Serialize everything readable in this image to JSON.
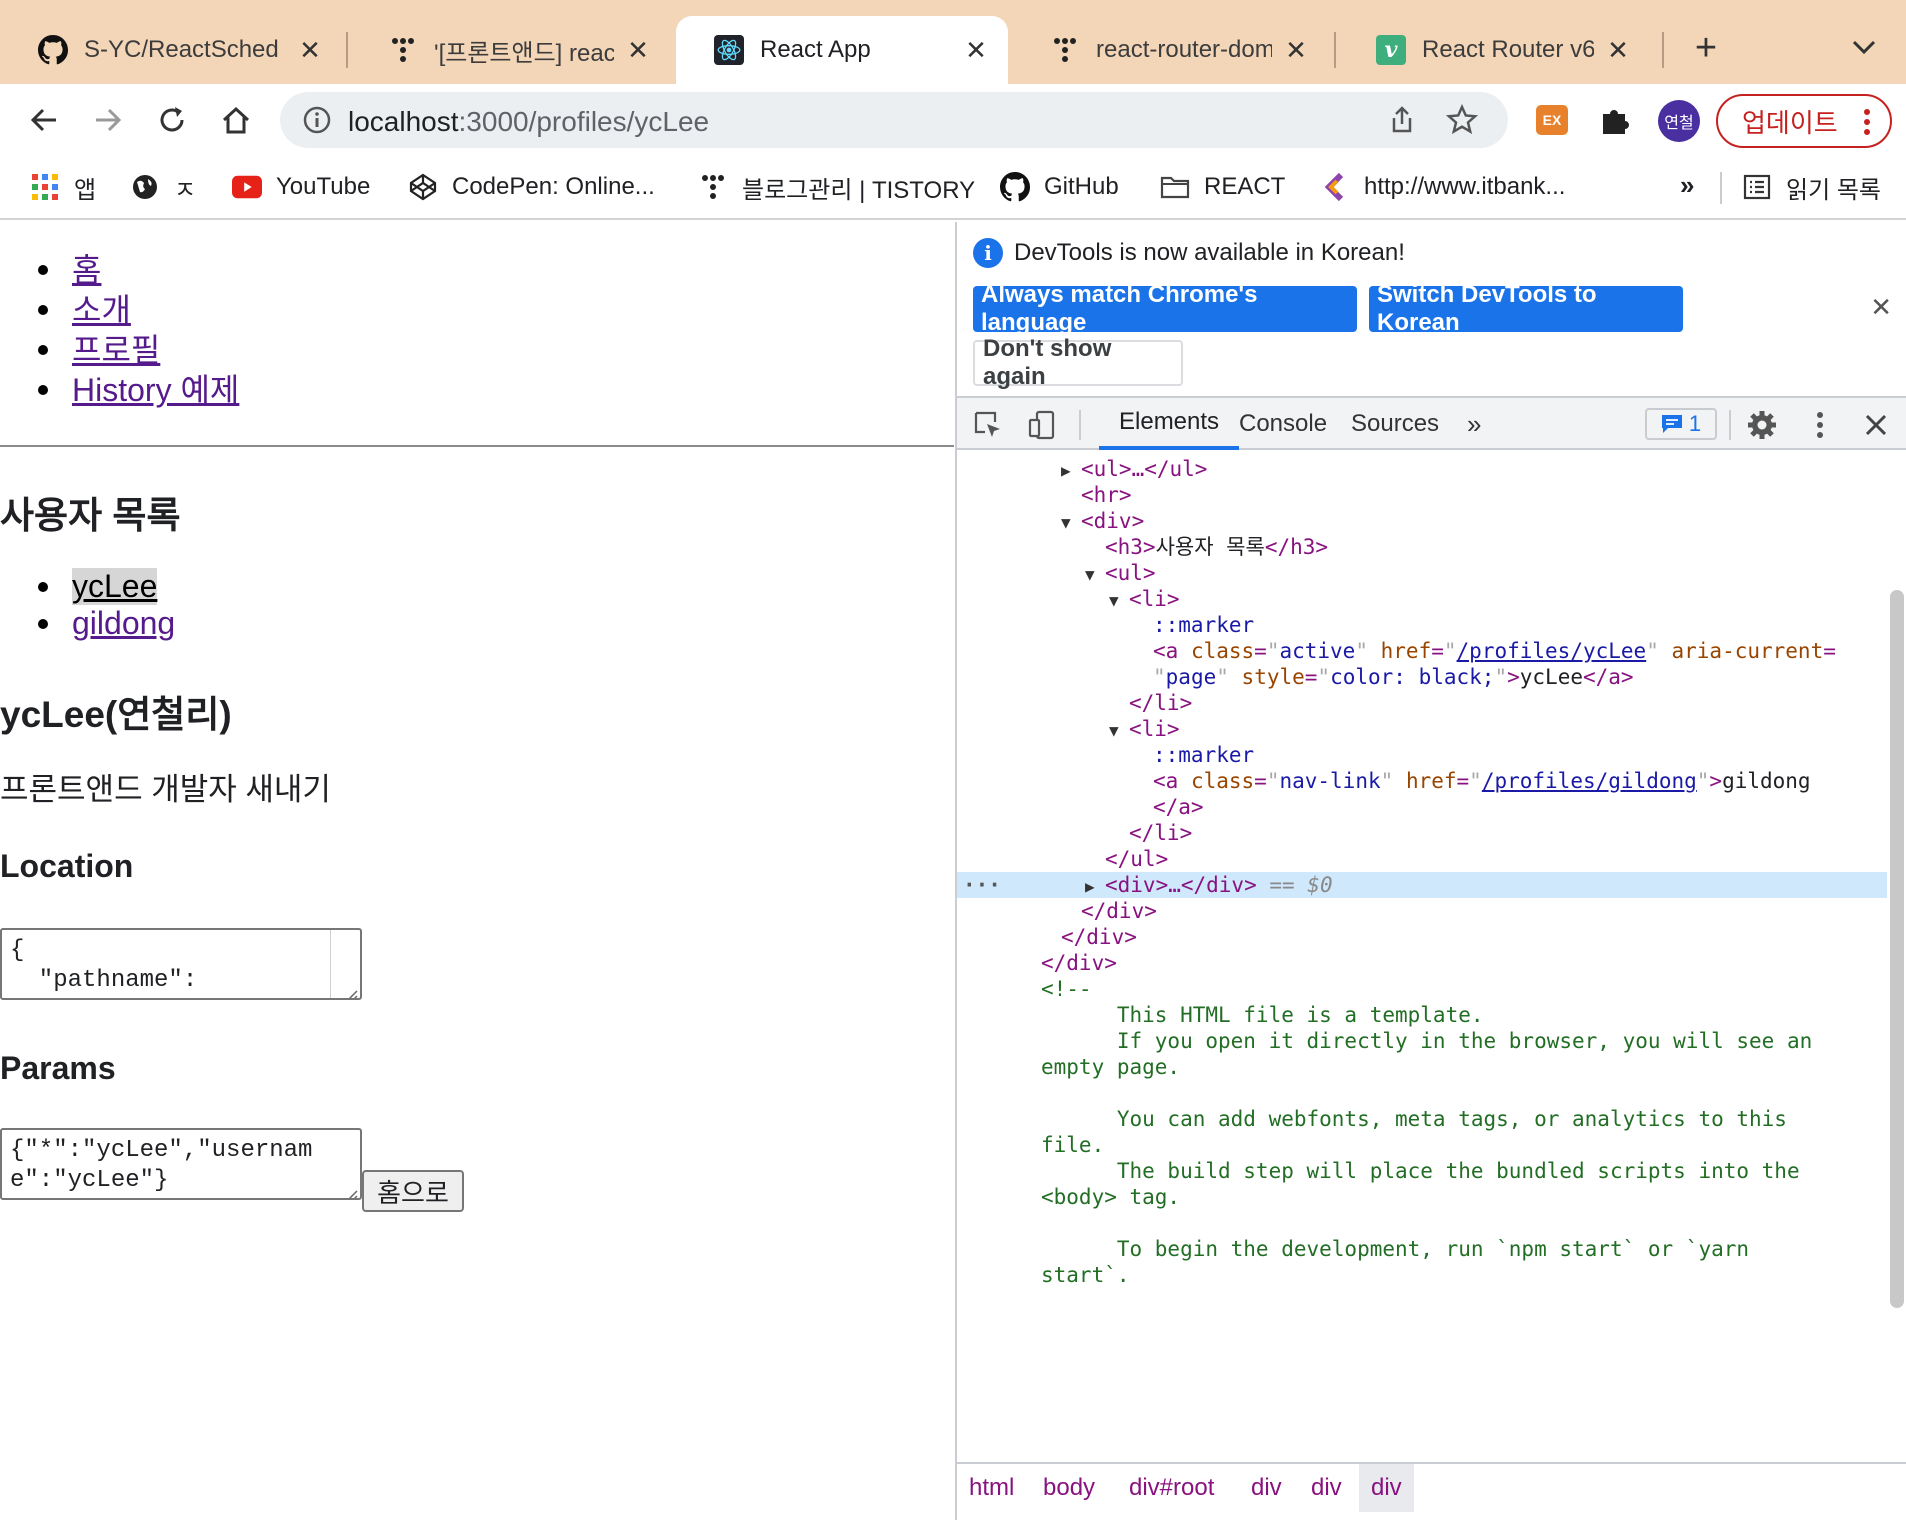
{
  "browser": {
    "tabs": [
      {
        "title": "S-YC/ReactSched",
        "icon": "github-icon",
        "active": false
      },
      {
        "title": "'[프론트앤드] react",
        "icon": "tistory-icon",
        "active": false
      },
      {
        "title": "React App",
        "icon": "react-icon",
        "active": true
      },
      {
        "title": "react-router-dom",
        "icon": "tistory-icon",
        "active": false
      },
      {
        "title": "React Router v6",
        "icon": "vuepress-icon",
        "active": false
      }
    ],
    "close_glyph": "✕",
    "new_tab_glyph": "+",
    "url": {
      "host": "localhost",
      "rest": ":3000/profiles/ycLee"
    },
    "extension_ex": "EX",
    "avatar_text": "연철",
    "update_label": "업데이트",
    "bookmarks": [
      {
        "label": "앱",
        "icon": "apps-grid-icon"
      },
      {
        "label": "ㅈ",
        "icon": "globe-icon"
      },
      {
        "label": "YouTube",
        "icon": "youtube-icon"
      },
      {
        "label": "CodePen: Online...",
        "icon": "codepen-icon"
      },
      {
        "label": "블로그관리 | TISTORY",
        "icon": "tistory-icon"
      },
      {
        "label": "GitHub",
        "icon": "github-icon"
      },
      {
        "label": "REACT",
        "icon": "folder-icon"
      },
      {
        "label": "http://www.itbank...",
        "icon": "itbank-icon"
      }
    ],
    "bookmarks_more": "»",
    "reading_list": "읽기 목록"
  },
  "page": {
    "nav": [
      "홈",
      "소개",
      "프로필",
      "History 예제"
    ],
    "users_title": "사용자 목록",
    "users": [
      "ycLee",
      "gildong"
    ],
    "profile_name": "ycLee(연철리)",
    "profile_desc": "프론트앤드 개발자 새내기",
    "location_title": "Location",
    "location_text": "{\n  \"pathname\":",
    "params_title": "Params",
    "params_text": "{\"*\":\"ycLee\",\"username\":\"ycLee\"}",
    "home_button": "홈으로"
  },
  "devtools": {
    "banner_msg": "DevTools is now available in Korean!",
    "btn_match": "Always match Chrome's language",
    "btn_switch": "Switch DevTools to Korean",
    "btn_dont_show": "Don't show again",
    "tabs": [
      "Elements",
      "Console",
      "Sources"
    ],
    "tabs_more": "»",
    "issues_count": "1",
    "dom": {
      "l_ul": "<ul>…</ul>",
      "l_hr": "<hr>",
      "l_div": "<div>",
      "h3_text": "사용자 목록",
      "marker": "::marker",
      "active_class": "active",
      "active_href": "/profiles/ycLee",
      "aria": "page",
      "style": "color: black;",
      "link1_text": "ycLee",
      "navlink_class": "nav-link",
      "navlink_href": "/profiles/gildong",
      "link2_text": "gildong",
      "eq0": "== $0",
      "comment_lines": [
        "      This HTML file is a template.",
        "      If you open it directly in the browser, you will see an",
        "empty page.",
        "",
        "      You can add webfonts, meta tags, or analytics to this",
        "file.",
        "      The build step will place the bundled scripts into the",
        "<body> tag.",
        "",
        "      To begin the development, run `npm start` or `yarn",
        "start`."
      ]
    },
    "crumbs": [
      "html",
      "body",
      "div#root",
      "div",
      "div",
      "div"
    ]
  }
}
